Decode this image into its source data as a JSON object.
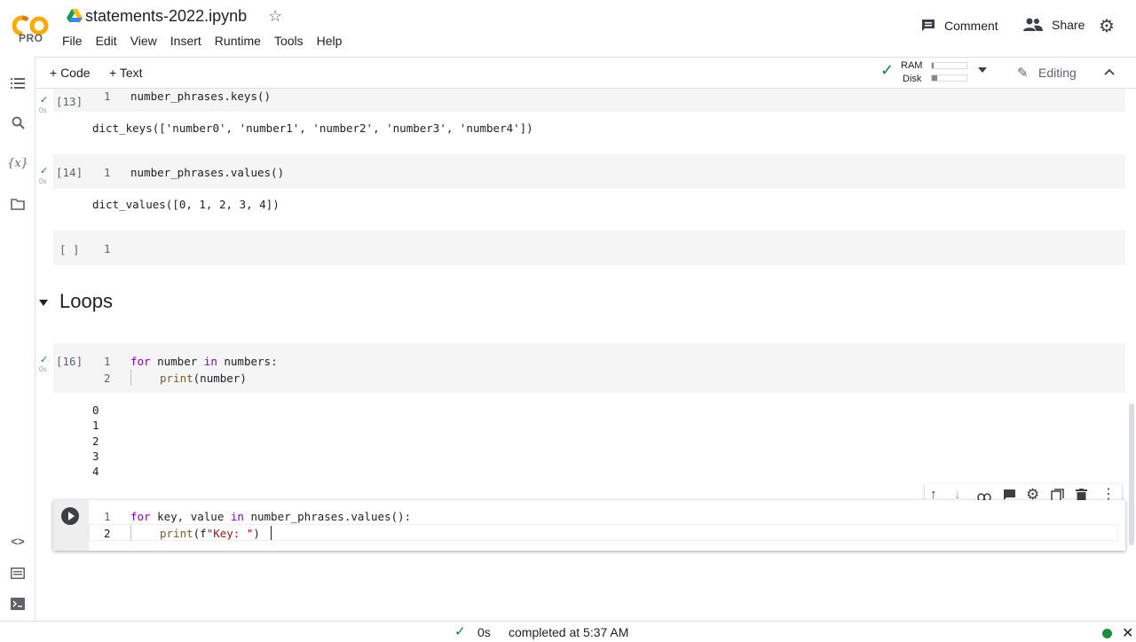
{
  "header": {
    "logo_text": "CO",
    "pro_label": "PRO",
    "title": "statements-2022.ipynb",
    "menu": [
      "File",
      "Edit",
      "View",
      "Insert",
      "Runtime",
      "Tools",
      "Help"
    ],
    "comment_label": "Comment",
    "share_label": "Share"
  },
  "toolbar": {
    "add_code": "+ Code",
    "add_text": "+ Text",
    "ram_label": "RAM",
    "disk_label": "Disk",
    "editing_label": "Editing"
  },
  "cells": {
    "c13": {
      "exec": "[13]",
      "line1": "1",
      "code1": "number_phrases.keys()",
      "time": "0s",
      "output": "dict_keys(['number0', 'number1', 'number2', 'number3', 'number4'])"
    },
    "c14": {
      "exec": "[14]",
      "line1": "1",
      "code1": "number_phrases.values()",
      "time": "0s",
      "output": "dict_values([0, 1, 2, 3, 4])"
    },
    "empty": {
      "exec": "[ ]",
      "line1": "1"
    },
    "section_title": "Loops",
    "c16": {
      "exec": "[16]",
      "time": "0s",
      "line1": "1",
      "line2": "2",
      "kw_for": "for",
      "var_number": " number ",
      "kw_in": "in",
      "rest1": " numbers:",
      "fn_print": "print",
      "rest2": "(number)",
      "outputs": [
        "0",
        "1",
        "2",
        "3",
        "4"
      ]
    },
    "active": {
      "line1": "1",
      "line2": "2",
      "kw_for": "for",
      "mid1": " key, value ",
      "kw_in": "in",
      "rest1": " number_phrases.values():",
      "fn_print": "print",
      "open": "(f",
      "str": "\"Key: \"",
      "close": ")"
    }
  },
  "status": {
    "time": "0s",
    "message": "completed at 5:37 AM"
  },
  "colors": {
    "accent_orange": "#f9ab00",
    "check_green": "#188038",
    "status_dot": "#1e8e3e"
  }
}
